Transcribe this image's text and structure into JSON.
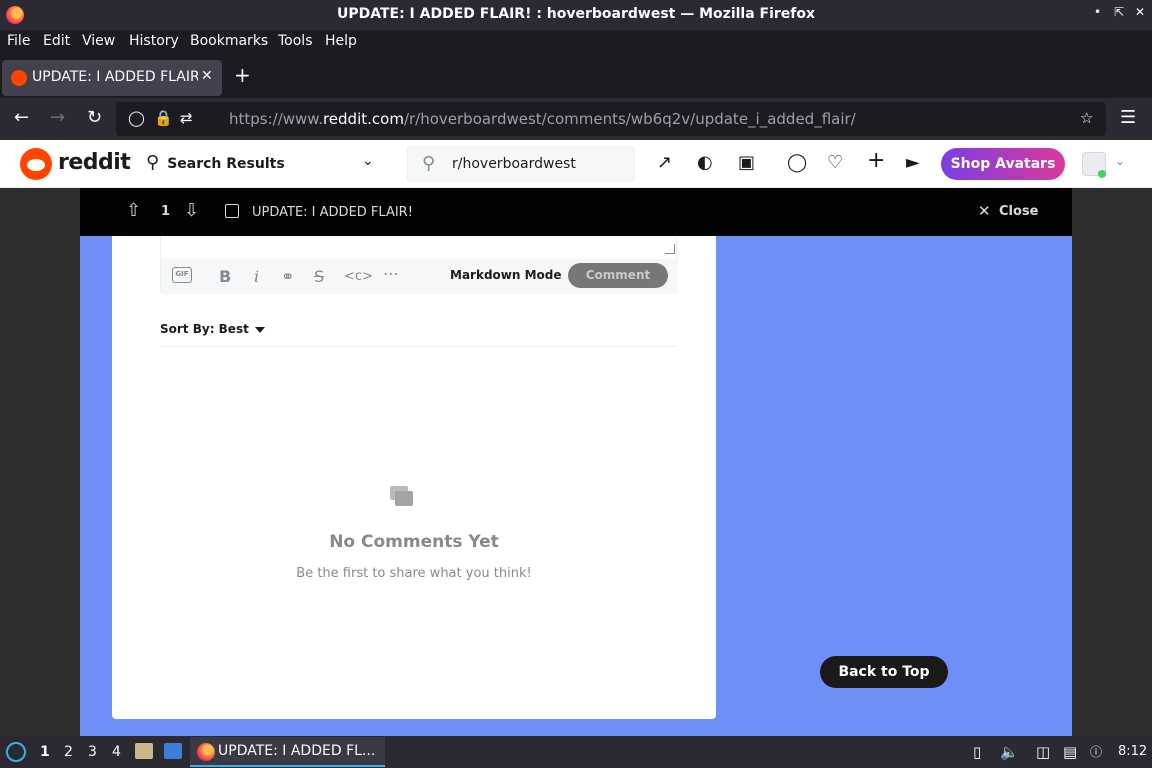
{
  "window": {
    "title": "UPDATE: I ADDED FLAIR! : hoverboardwest — Mozilla Firefox",
    "controls": [
      "minimize",
      "maximize",
      "close"
    ]
  },
  "menu": {
    "items": [
      "File",
      "Edit",
      "View",
      "History",
      "Bookmarks",
      "Tools",
      "Help"
    ]
  },
  "tabs": [
    {
      "label": "UPDATE: I ADDED FLAIR!",
      "active": true
    }
  ],
  "nav": {
    "url_prefix": "https://www.",
    "url_host": "reddit.com",
    "url_path": "/r/hoverboardwest/comments/wb6q2v/update_i_added_flair/"
  },
  "reddit_header": {
    "logo_text": "reddit",
    "search_results_label": "Search Results",
    "subreddit_search": "r/hoverboardwest",
    "shop_avatars": "Shop Avatars"
  },
  "post_bar": {
    "vote_count": "1",
    "title": "UPDATE: I ADDED FLAIR!",
    "close_label": "Close"
  },
  "comment_editor": {
    "gif_label": "GIF",
    "markdown_mode": "Markdown Mode",
    "comment_button": "Comment"
  },
  "comments": {
    "sort_label": "Sort By: Best",
    "empty_title": "No Comments Yet",
    "empty_subtitle": "Be the first to share what you think!"
  },
  "back_to_top": "Back to Top",
  "taskbar": {
    "workspaces": [
      "1",
      "2",
      "3",
      "4"
    ],
    "active_task": "UPDATE: I ADDED FL...",
    "clock": "8:12"
  },
  "colors": {
    "reddit_orange": "#ff4500",
    "subreddit_bg": "#6e8ff7",
    "post_bar": "#030303"
  }
}
